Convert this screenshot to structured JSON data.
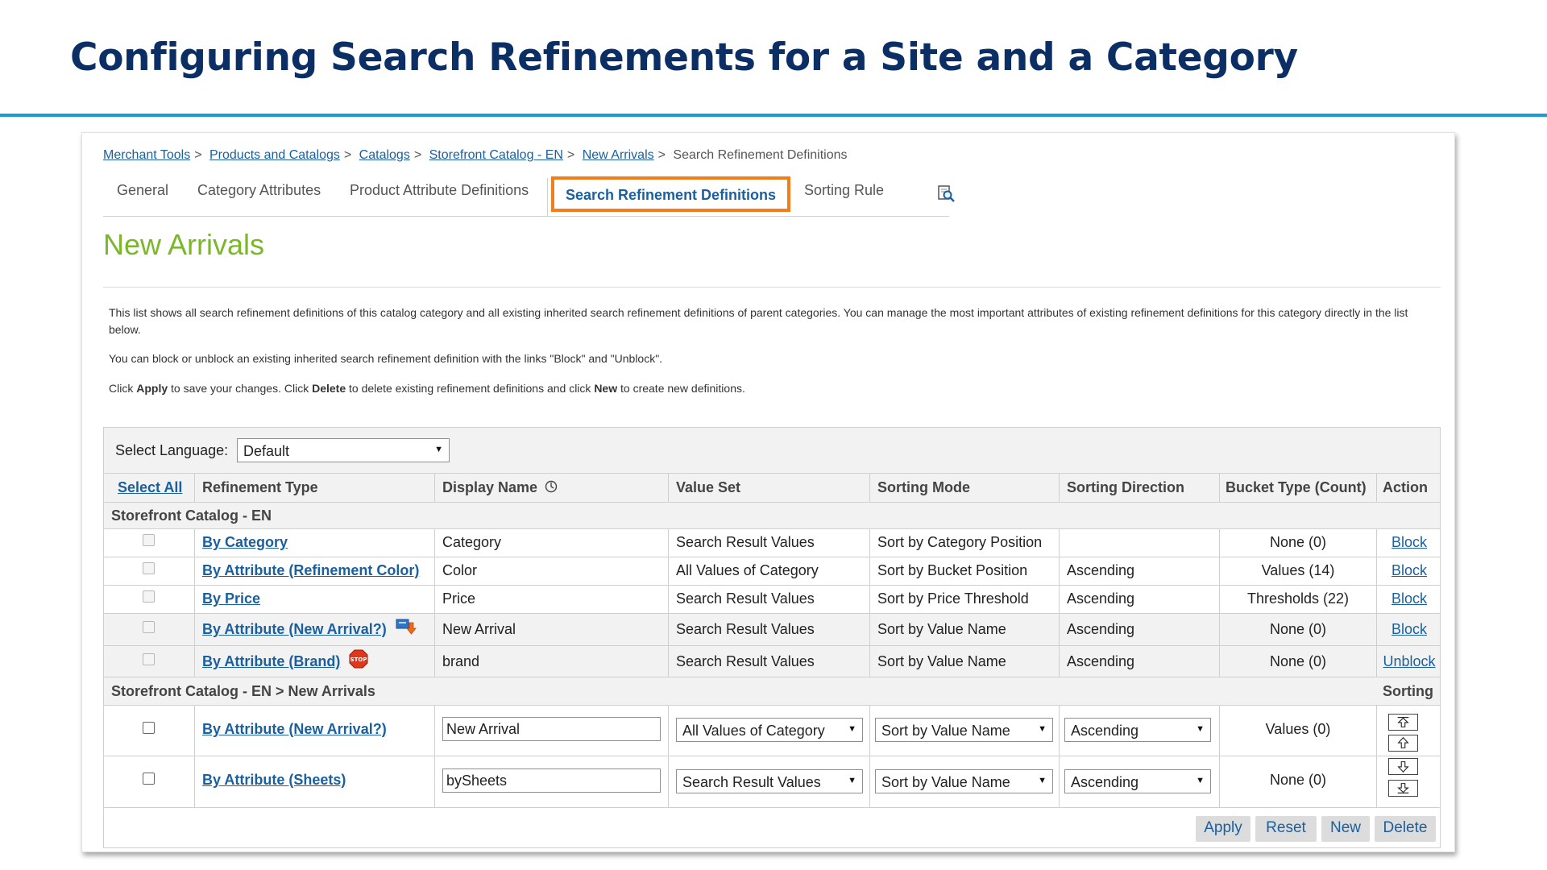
{
  "slide": {
    "title": "Configuring Search Refinements for a Site and a Category"
  },
  "breadcrumb": {
    "items": [
      "Merchant Tools",
      "Products and Catalogs",
      "Catalogs",
      "Storefront Catalog - EN",
      "New Arrivals"
    ],
    "separator": ">",
    "current": "Search Refinement Definitions"
  },
  "tabs": {
    "items": [
      {
        "label": "General"
      },
      {
        "label": "Category Attributes"
      },
      {
        "label": "Product Attribute Definitions"
      },
      {
        "label": "Search Refinement Definitions",
        "active": true
      },
      {
        "label": "Sorting Rule"
      }
    ],
    "extra_icon": "preview-search-icon"
  },
  "page": {
    "heading": "New Arrivals",
    "intro": {
      "p1": "This list shows all search refinement definitions of this catalog category and all existing inherited search refinement definitions of parent categories. You can manage the most important attributes of existing refinement definitions for this category directly in the list below.",
      "p2": "You can block or unblock an existing inherited search refinement definition with the links \"Block\" and \"Unblock\".",
      "p3_a": "Click ",
      "p3_apply": "Apply",
      "p3_b": " to save your changes. Click ",
      "p3_delete": "Delete",
      "p3_c": " to delete existing refinement definitions and click ",
      "p3_new": "New",
      "p3_d": " to create new definitions."
    }
  },
  "grid": {
    "language_label": "Select Language:",
    "language_value": "Default",
    "headers": {
      "select_all": "Select All",
      "refinement_type": "Refinement Type",
      "display_name": "Display Name",
      "value_set": "Value Set",
      "sorting_mode": "Sorting Mode",
      "sorting_direction": "Sorting Direction",
      "bucket_type": "Bucket Type (Count)",
      "action": "Action"
    },
    "group_inherited": "Storefront Catalog - EN",
    "inherited_rows": [
      {
        "type": "By Category",
        "display": "Category",
        "value_set": "Search Result Values",
        "sorting_mode": "Sort by Category Position",
        "direction": "",
        "bucket": "None (0)",
        "action": "Block"
      },
      {
        "type": "By Attribute (Refinement Color)",
        "display": "Color",
        "value_set": "All Values of Category",
        "sorting_mode": "Sort by Bucket Position",
        "direction": "Ascending",
        "bucket": "Values (14)",
        "action": "Block"
      },
      {
        "type": "By Price",
        "display": "Price",
        "value_set": "Search Result Values",
        "sorting_mode": "Sort by Price Threshold",
        "direction": "Ascending",
        "bucket": "Thresholds (22)",
        "action": "Block"
      },
      {
        "type": "By Attribute (New Arrival?)",
        "display": "New Arrival",
        "value_set": "Search Result Values",
        "sorting_mode": "Sort by Value Name",
        "direction": "Ascending",
        "bucket": "None (0)",
        "action": "Block",
        "icon": "overridden-icon"
      },
      {
        "type": "By Attribute (Brand)",
        "display": "brand",
        "value_set": "Search Result Values",
        "sorting_mode": "Sort by Value Name",
        "direction": "Ascending",
        "bucket": "None (0)",
        "action": "Unblock",
        "icon": "stop-icon",
        "stop_text": "STOP"
      }
    ],
    "group_local": "Storefront Catalog - EN > New Arrivals",
    "sorting_label": "Sorting",
    "local_rows": [
      {
        "type": "By Attribute (New Arrival?)",
        "display": "New Arrival",
        "value_set": "All Values of Category",
        "sorting_mode": "Sort by Value Name",
        "direction": "Ascending",
        "bucket": "Values (0)"
      },
      {
        "type": "By Attribute (Sheets)",
        "display": "bySheets",
        "value_set": "Search Result Values",
        "sorting_mode": "Sort by Value Name",
        "direction": "Ascending",
        "bucket": "None (0)"
      }
    ],
    "sort_buttons": [
      "move-top-icon",
      "move-up-icon",
      "move-down-icon",
      "move-bottom-icon"
    ],
    "buttons": {
      "apply": "Apply",
      "reset": "Reset",
      "new": "New",
      "delete": "Delete"
    },
    "colors": {
      "link": "#1a5f9e",
      "heading": "#7ab829",
      "active_tab_border": "#f07e1a",
      "title": "#0b2f64",
      "rule": "#1a9ad6"
    }
  }
}
